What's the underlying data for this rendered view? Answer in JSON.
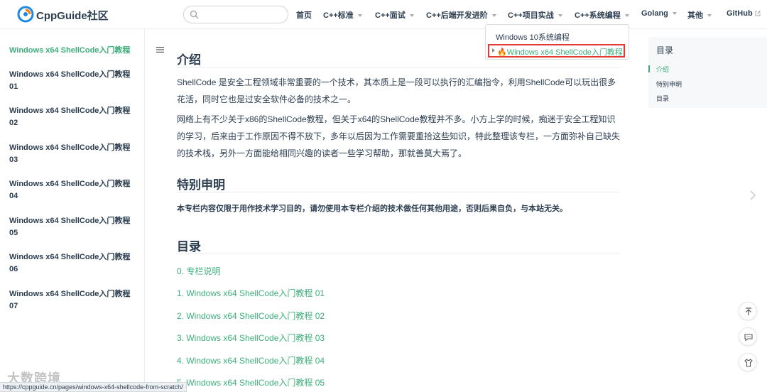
{
  "brand": {
    "name": "CppGuide社区"
  },
  "search": {
    "placeholder": ""
  },
  "nav": {
    "items": [
      {
        "label": "首页",
        "dropdown": false
      },
      {
        "label": "C++标准",
        "dropdown": true
      },
      {
        "label": "C++面试",
        "dropdown": true
      },
      {
        "label": "C++后端开发进阶",
        "dropdown": true
      },
      {
        "label": "C++项目实战",
        "dropdown": true
      },
      {
        "label": "C++系统编程",
        "dropdown": true
      },
      {
        "label": "Golang",
        "dropdown": true
      },
      {
        "label": "其他",
        "dropdown": true
      },
      {
        "label": "GitHub",
        "dropdown": false,
        "external": true
      }
    ]
  },
  "dropdown": {
    "items": [
      {
        "label": "Windows 10系统编程"
      },
      {
        "label": "🔥Windows x64 ShellCode入门教程",
        "highlighted": true
      }
    ]
  },
  "sidebar": {
    "items": [
      {
        "label": "Windows x64 ShellCode入门教程",
        "active": true
      },
      {
        "label": "Windows x64 ShellCode入门教程 01"
      },
      {
        "label": "Windows x64 ShellCode入门教程 02"
      },
      {
        "label": "Windows x64 ShellCode入门教程 03"
      },
      {
        "label": "Windows x64 ShellCode入门教程 04"
      },
      {
        "label": "Windows x64 ShellCode入门教程 05"
      },
      {
        "label": "Windows x64 ShellCode入门教程 06"
      },
      {
        "label": "Windows x64 ShellCode入门教程 07"
      }
    ]
  },
  "content": {
    "sections": [
      {
        "title": "介绍"
      },
      {
        "title": "特别申明"
      },
      {
        "title": "目录"
      }
    ],
    "intro_p1": "ShellCode 是安全工程领域非常重要的一个技术，其本质上是一段可以执行的汇编指令，利用ShellCode可以玩出很多花活，同时它也是过安全软件必备的技术之一。",
    "intro_p2": "网络上有不少关于x86的ShellCode教程，但关于x64的ShellCode教程并不多。小方上学的时候，痴迷于安全工程知识的学习，后来由于工作原因不得不放下，多年以后因为工作需要重拾这些知识，特此整理该专栏，一方面弥补自己缺失的技术栈，另外一方面能给相同兴趣的读者一些学习帮助，那就善莫大焉了。",
    "notice": "本专栏内容仅限于用作技术学习目的，请勿使用本专栏介绍的技术做任何其他用途，否则后果自负，与本站无关。",
    "toc": [
      "0. 专栏说明",
      "1. Windows x64 ShellCode入门教程 01",
      "2. Windows x64 ShellCode入门教程 02",
      "3. Windows x64 ShellCode入门教程 03",
      "4. Windows x64 ShellCode入门教程 04",
      "5. Windows x64 ShellCode入门教程 05"
    ]
  },
  "right_toc": {
    "title": "目录",
    "items": [
      {
        "label": "介绍",
        "active": true
      },
      {
        "label": "特别申明"
      },
      {
        "label": "目录"
      }
    ]
  },
  "status_url": "https://cppguide.cn/pages/windows-x64-shellcode-from-scratch/",
  "watermark": "大数跨境",
  "colors": {
    "accent": "#3eaf7c",
    "text": "#2c3e50",
    "highlight_border": "#e53935"
  },
  "icons": [
    "logo-icon",
    "search-icon",
    "external-link-icon",
    "hamburger-icon",
    "chevron-right-icon",
    "back-to-top-icon",
    "comment-icon",
    "theme-icon"
  ]
}
